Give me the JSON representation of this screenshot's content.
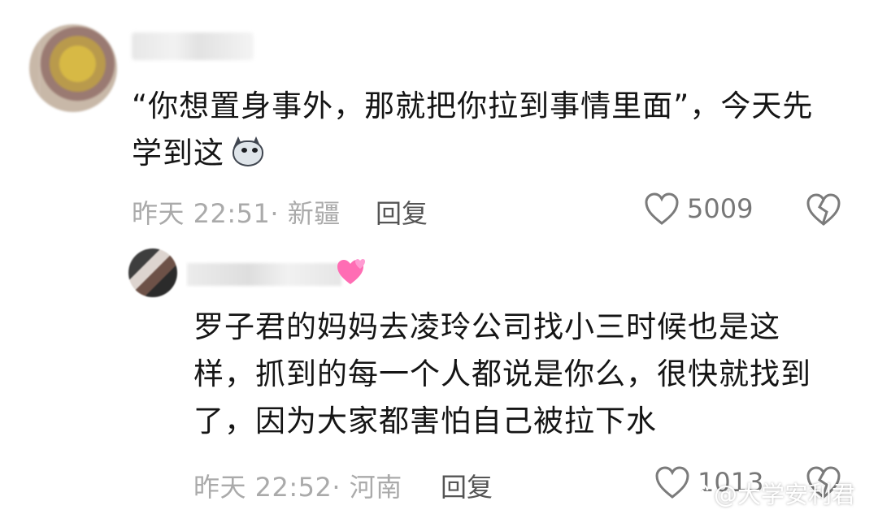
{
  "comments": [
    {
      "text_line1": "“你想置身事外，那就把你拉到事情里面”，今天先",
      "text_line2": "学到这",
      "emoji_icon": "husky-dog-icon",
      "time_location": "昨天 22:51· 新疆",
      "reply_label": "回复",
      "like_count": "5009"
    }
  ],
  "replies": [
    {
      "text_line1": "罗子君的妈妈去凌玲公司找小三时候也是这",
      "text_line2": "样，抓到的每一个人都说是你么，很快就找到",
      "text_line3": "了，因为大家都害怕自己被拉下水",
      "time_location": "昨天 22:52· 河南",
      "reply_label": "回复",
      "like_count": "1013"
    }
  ],
  "watermark": {
    "text": "@大学安利君",
    "icon": "weibo-icon"
  },
  "colors": {
    "meta_text": "#aaaaaa",
    "body_text": "#151515",
    "reply_text": "#555555"
  }
}
